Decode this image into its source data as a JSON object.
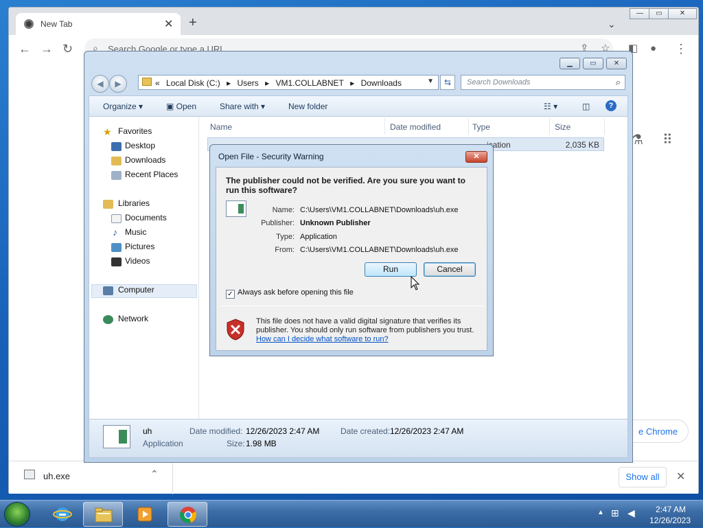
{
  "chrome": {
    "tab_title": "New Tab",
    "tab_close": "✕",
    "new_tab": "+",
    "omnibox_placeholder": "Search Google or type a URL",
    "customize_label": "Customize Chrome",
    "customize_visible": "e Chrome",
    "download_item": "uh.exe",
    "show_all": "Show all",
    "icons": [
      "chrome-logo-icon",
      "back-icon",
      "forward-icon",
      "reload-icon",
      "share-icon",
      "bookmark-star-icon",
      "side-panel-icon",
      "profile-icon",
      "kebab-menu-icon",
      "labs-icon",
      "apps-grid-icon"
    ]
  },
  "explorer": {
    "address_crumbs": [
      "«",
      "Local Disk (C:)",
      "▸",
      "Users",
      "▸",
      "VM1.COLLABNET",
      "▸",
      "Downloads"
    ],
    "search_placeholder": "Search Downloads",
    "commands": {
      "organize": "Organize ▾",
      "open": "Open",
      "share_with": "Share with ▾",
      "new_folder": "New folder"
    },
    "nav": {
      "favorites": "Favorites",
      "desktop": "Desktop",
      "downloads": "Downloads",
      "recent_places": "Recent Places",
      "libraries": "Libraries",
      "documents": "Documents",
      "music": "Music",
      "pictures": "Pictures",
      "videos": "Videos",
      "computer": "Computer",
      "network": "Network"
    },
    "columns": {
      "name": "Name",
      "date_modified": "Date modified",
      "type": "Type",
      "size": "Size"
    },
    "file_row": {
      "type_partial": "ication",
      "size": "2,035 KB"
    },
    "details": {
      "name": "uh",
      "kind": "Application",
      "date_modified_label": "Date modified:",
      "date_modified": "12/26/2023 2:47 AM",
      "date_created_label": "Date created:",
      "date_created": "12/26/2023 2:47 AM",
      "size_label": "Size:",
      "size": "1.98 MB"
    }
  },
  "dialog": {
    "title": "Open File - Security Warning",
    "question": "The publisher could not be verified.  Are you sure you want to run this software?",
    "name_label": "Name:",
    "name_value": "C:\\Users\\VM1.COLLABNET\\Downloads\\uh.exe",
    "publisher_label": "Publisher:",
    "publisher_value": "Unknown Publisher",
    "type_label": "Type:",
    "type_value": "Application",
    "from_label": "From:",
    "from_value": "C:\\Users\\VM1.COLLABNET\\Downloads\\uh.exe",
    "run": "Run",
    "cancel": "Cancel",
    "always_ask": "Always ask before opening this file",
    "always_ask_checked": true,
    "warning_text": "This file does not have a valid digital signature that verifies its publisher.  You should only run software from publishers you trust.",
    "help_link": "How can I decide what software to run?"
  },
  "taskbar": {
    "time": "2:47 AM",
    "date": "12/26/2023",
    "apps": [
      "internet-explorer-icon",
      "windows-explorer-icon",
      "media-player-icon",
      "chrome-icon"
    ]
  }
}
